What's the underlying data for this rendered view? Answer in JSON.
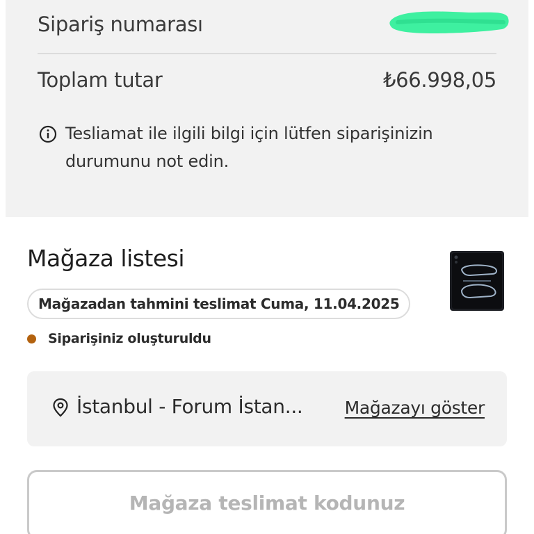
{
  "summary": {
    "order_number_label": "Sipariş numarası",
    "total_label": "Toplam tutar",
    "total_value": "₺66.998,05",
    "info_text": "Tesliamat ile ilgili bilgi için lütfen siparişinizin durumunu not edin.",
    "redaction_color": "#3ef0a0"
  },
  "store_list": {
    "title": "Mağaza listesi",
    "estimated_delivery": "Mağazadan tahmini teslimat Cuma, 11.04.2025",
    "status_text": "Siparişiniz oluşturuldu",
    "status_color": "#b3620f",
    "store_name": "İstanbul - Forum İstan...",
    "show_store_link": "Mağazayı göster",
    "delivery_code_button": "Mağaza teslimat kodunuz"
  },
  "icons": {
    "info": "info-icon",
    "location": "location-pin-icon"
  }
}
